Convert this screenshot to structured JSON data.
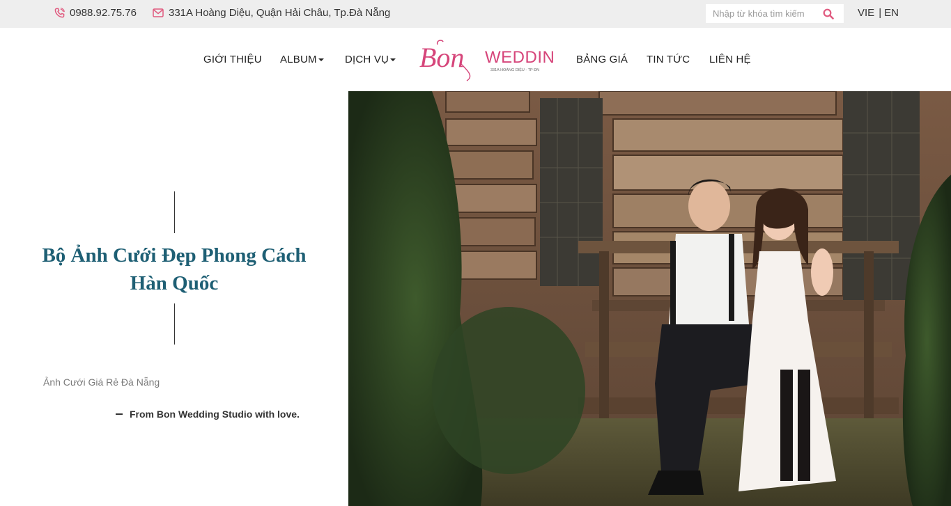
{
  "topbar": {
    "phone": "0988.92.75.76",
    "address": "331A Hoàng Diệu, Quận Hải Châu, Tp.Đà Nẵng",
    "search_placeholder": "Nhập từ khóa tìm kiếm",
    "languages": [
      "VIE",
      "EN"
    ],
    "accent_color": "#e05a7f"
  },
  "nav": {
    "items_left": [
      "GIỚI THIỆU",
      "ALBUM",
      "DỊCH VỤ"
    ],
    "items_right": [
      "BẢNG GIÁ",
      "TIN TỨC",
      "LIÊN HỆ"
    ],
    "logo": {
      "script_text": "Bon",
      "word_text": "WEDDING",
      "tagline": "331A HOÀNG DIỆU - TP ĐN",
      "color": "#d6457a"
    }
  },
  "hero": {
    "title": "Bộ Ảnh Cưới Đẹp Phong Cách Hàn Quốc",
    "subtitle": "Ảnh Cưới Giá Rẻ Đà Nẵng",
    "signature": "From Bon Wedding Studio with love.",
    "title_color": "#1e5f74"
  }
}
